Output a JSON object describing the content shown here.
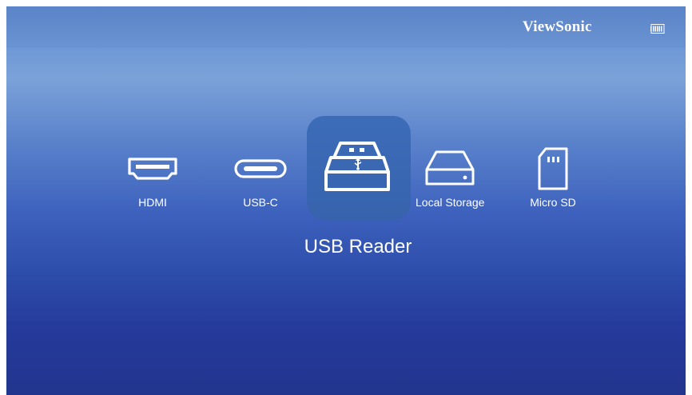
{
  "header": {
    "brand": "ViewSonic",
    "battery_icon": "battery-icon"
  },
  "sources": [
    {
      "label": "HDMI",
      "icon": "hdmi-icon"
    },
    {
      "label": "USB-C",
      "icon": "usb-c-icon"
    },
    {
      "label": "USB Reader",
      "icon": "usb-drive-icon",
      "selected": true
    },
    {
      "label": "Local Storage",
      "icon": "hard-drive-icon"
    },
    {
      "label": "Micro SD",
      "icon": "micro-sd-icon"
    }
  ],
  "selected_label": "USB Reader",
  "colors": {
    "accent_tile": "#3a68b2",
    "background_top": "#6d98d6",
    "background_bottom": "#22358e"
  }
}
